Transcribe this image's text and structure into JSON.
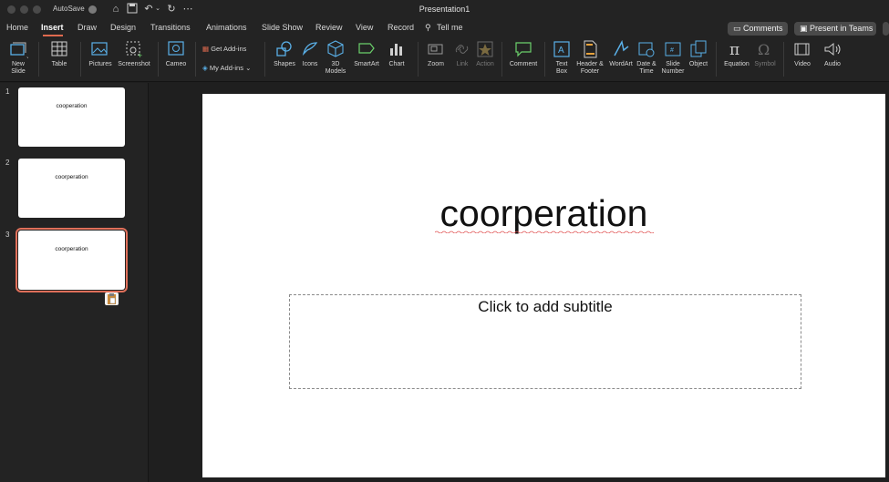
{
  "titlebar": {
    "autosave_label": "AutoSave",
    "doc_title": "Presentation1"
  },
  "tabs": [
    "Home",
    "Insert",
    "Draw",
    "Design",
    "Transitions",
    "Animations",
    "Slide Show",
    "Review",
    "View",
    "Record",
    "Tell me"
  ],
  "active_tab": "Insert",
  "top_right": {
    "comments": "Comments",
    "present_teams": "Present in Teams"
  },
  "ribbon": {
    "new_slide": "New\nSlide",
    "table": "Table",
    "pictures": "Pictures",
    "screenshot": "Screenshot",
    "cameo": "Cameo",
    "get_addins": "Get Add-ins",
    "my_addins": "My Add-ins",
    "shapes": "Shapes",
    "icons": "Icons",
    "models3d": "3D\nModels",
    "smartart": "SmartArt",
    "chart": "Chart",
    "zoom": "Zoom",
    "link": "Link",
    "action": "Action",
    "comment": "Comment",
    "textbox": "Text\nBox",
    "header_footer": "Header &\nFooter",
    "wordart": "WordArt",
    "datetime": "Date &\nTime",
    "slide_number": "Slide\nNumber",
    "object": "Object",
    "equation": "Equation",
    "symbol": "Symbol",
    "video": "Video",
    "audio": "Audio"
  },
  "slides": [
    {
      "number": "1",
      "title": "cooperation"
    },
    {
      "number": "2",
      "title": "coorperation"
    },
    {
      "number": "3",
      "title": "coorperation"
    }
  ],
  "current_slide": {
    "title": "coorperation",
    "subtitle_placeholder": "Click to add subtitle"
  },
  "colors": {
    "accent": "#e06a4f",
    "ribbon_bg": "#232323",
    "slide_bg": "#ffffff"
  }
}
